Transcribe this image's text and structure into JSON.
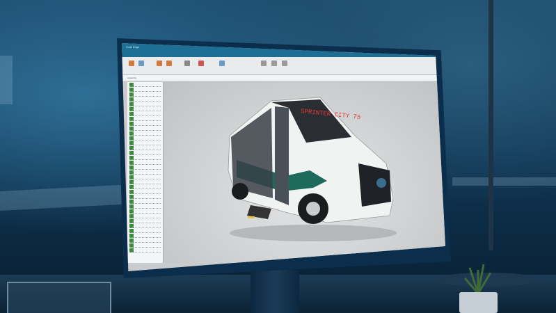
{
  "scene": {
    "description_tag": "cad-workstation"
  },
  "app": {
    "title": "Solid Edge",
    "tab_active": "Assembly"
  },
  "viewport": {
    "bus_destination_sign": "SPRINTER CITY 75",
    "bus_color": "#1d6b5a",
    "screen_accent": "#1d6f93"
  }
}
